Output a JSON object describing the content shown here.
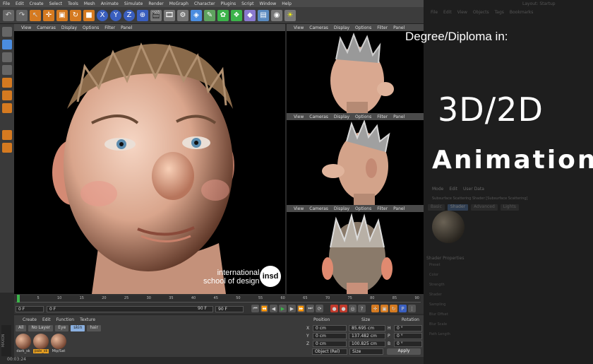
{
  "menu": [
    "File",
    "Edit",
    "Create",
    "Select",
    "Tools",
    "Mesh",
    "Animate",
    "Simulate",
    "Render",
    "MoGraph",
    "Character",
    "Plugins",
    "Script",
    "Window",
    "Help"
  ],
  "viewport_menu": [
    "View",
    "Cameras",
    "Display",
    "Options",
    "Filter",
    "Panel"
  ],
  "timeline": {
    "ticks": [
      "0",
      "5",
      "10",
      "15",
      "20",
      "25",
      "30",
      "35",
      "40",
      "45",
      "50",
      "55",
      "60",
      "65",
      "70",
      "75",
      "80",
      "85",
      "90"
    ],
    "start_frame": "0 F",
    "current_frame": "0 F",
    "end_frame": "90 F",
    "end_frame2": "90 F"
  },
  "material_menu": [
    "Create",
    "Edit",
    "Function",
    "Texture"
  ],
  "material_tags": [
    "All",
    "No Layer",
    "Eye",
    "skin",
    "hair"
  ],
  "materials": [
    "dark_sk",
    "pale_sk",
    "Mip/Sat"
  ],
  "coords": {
    "headers": [
      "Position",
      "Size",
      "Rotation"
    ],
    "rows": [
      {
        "axis": "X",
        "pos": "0 cm",
        "size": "85.695 cm",
        "rot_axis": "H",
        "rot": "0 °"
      },
      {
        "axis": "Y",
        "pos": "0 cm",
        "size": "137.482 cm",
        "rot_axis": "P",
        "rot": "0 °"
      },
      {
        "axis": "Z",
        "pos": "0 cm",
        "size": "100.825 cm",
        "rot_axis": "B",
        "rot": "0 °"
      }
    ],
    "mode": "Object (Rel)",
    "size_mode": "Size",
    "apply": "Apply"
  },
  "status_time": "00:03:24",
  "overlay": {
    "subtitle": "Degree/Diploma in:",
    "title": "3D/2D",
    "headline": "Animation"
  },
  "logo": {
    "line1": "international",
    "line2": "school of design",
    "badge": "insd"
  },
  "right_panel": {
    "menu": [
      "File",
      "Edit",
      "View",
      "Objects",
      "Tags",
      "Bookmarks"
    ],
    "layout_label": "Layout:",
    "layout_value": "Startup",
    "attr_menu": [
      "Mode",
      "Edit",
      "User Data"
    ],
    "shader_title": "Subsurface Scattering Shader [Subsurface Scattering]",
    "shader_tabs": [
      "Basic",
      "Shader",
      "Advanced",
      "Lights"
    ],
    "shader_props": "Shader Properties",
    "props": [
      "Preset",
      "Color",
      "Strength",
      "Shader",
      "Sampling",
      "Blur Offset",
      "Blur Scale",
      "Path Length"
    ]
  },
  "colors": {
    "ui_bg": "#3a3a3a",
    "viewport_bg": "#000000",
    "accent_orange": "#e8a020",
    "skin": "#e8b89a"
  }
}
